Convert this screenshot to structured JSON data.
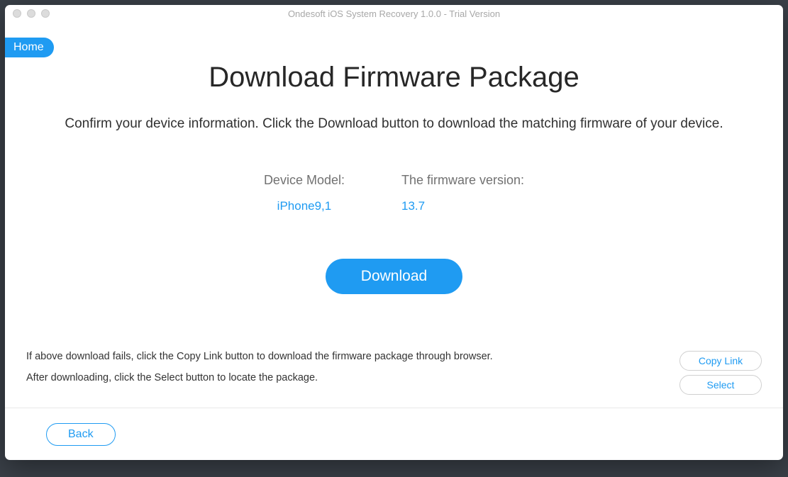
{
  "window": {
    "title": "Ondesoft iOS System Recovery 1.0.0 - Trial Version"
  },
  "nav": {
    "home_label": "Home"
  },
  "page": {
    "title": "Download Firmware Package",
    "subtitle": "Confirm your device information. Click the Download button to download the matching firmware of your device."
  },
  "device": {
    "model_label": "Device Model:",
    "model_value": "iPhone9,1",
    "firmware_label": "The firmware version:",
    "firmware_value": "13.7"
  },
  "actions": {
    "download_label": "Download"
  },
  "help": {
    "line1": "If above download fails, click the Copy Link button to download the firmware package through browser.",
    "line2": "After downloading, click the Select button to locate the package.",
    "copy_link_label": "Copy Link",
    "select_label": "Select"
  },
  "footer": {
    "back_label": "Back"
  }
}
